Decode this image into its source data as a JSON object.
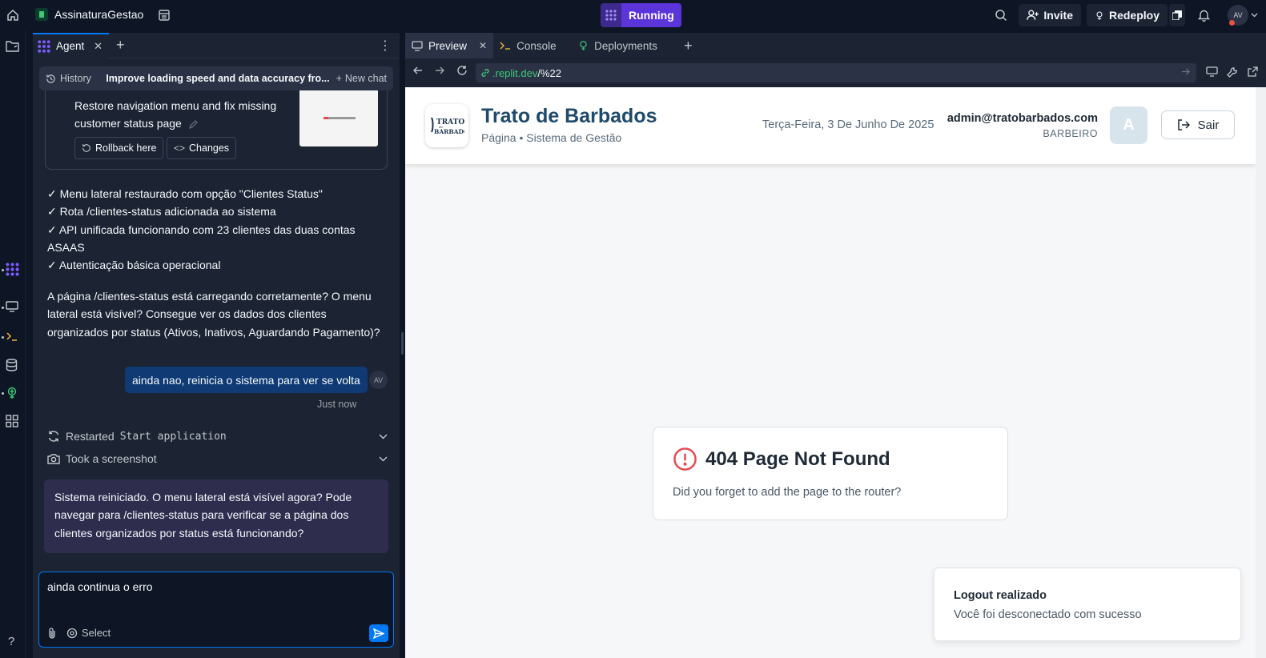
{
  "topbar": {
    "app_name": "AssinaturaGestao",
    "run_status": "Running",
    "invite_label": "Invite",
    "redeploy_label": "Redeploy",
    "avatar_initials": "AV"
  },
  "agent_panel": {
    "tab_label": "Agent",
    "history_label": "History",
    "chat_title": "Improve loading speed and data accuracy fro...",
    "new_chat_label": "New chat",
    "checkpoint": {
      "text": "Restore navigation menu and fix missing customer status page",
      "rollback_label": "Rollback here",
      "changes_label": "Changes"
    },
    "summary_items": [
      "✓ Menu lateral restaurado com opção \"Clientes Status\"",
      "✓ Rota /clientes-status adicionada ao sistema",
      "✓ API unificada funcionando com 23 clientes das duas contas ASAAS",
      "✓ Autenticação básica operacional"
    ],
    "question": "A página /clientes-status está carregando corretamente? O menu lateral está visível? Consegue ver os dados dos clientes organizados por status (Ativos, Inativos, Aguardando Pagamento)?",
    "user_message": "ainda nao, reinicia o sistema para ver se volta",
    "user_initials": "AV",
    "user_time": "Just now",
    "actions": [
      {
        "prefix": "Restarted",
        "detail": "Start application"
      },
      {
        "prefix": "Took a screenshot",
        "detail": ""
      }
    ],
    "agent_reply": "Sistema reiniciado. O menu lateral está visível agora? Pode navegar para /clientes-status para verificar se a página dos clientes organizados por status está funcionando?",
    "composer_text": "ainda continua o erro",
    "select_label": "Select"
  },
  "right_panel": {
    "tabs": [
      "Preview",
      "Console",
      "Deployments"
    ],
    "url_domain": ".replit.dev",
    "url_path": "/%22"
  },
  "site": {
    "brand_title": "Trato de Barbados",
    "brand_subtitle": "Página • Sistema de Gestão",
    "logo_text": "TRATO de BARBADOS",
    "date": "Terça-Feira, 3 De Junho De 2025",
    "email": "admin@tratobarbados.com",
    "role": "BARBEIRO",
    "avatar_letter": "A",
    "logout_label": "Sair",
    "error_title": "404 Page Not Found",
    "error_desc": "Did you forget to add the page to the router?",
    "toast_title": "Logout realizado",
    "toast_desc": "Você foi desconectado com sucesso"
  },
  "colors": {
    "accent": "#0079f2",
    "running": "#5b34da",
    "brand": "#1e4a6b",
    "error": "#e5484d"
  }
}
